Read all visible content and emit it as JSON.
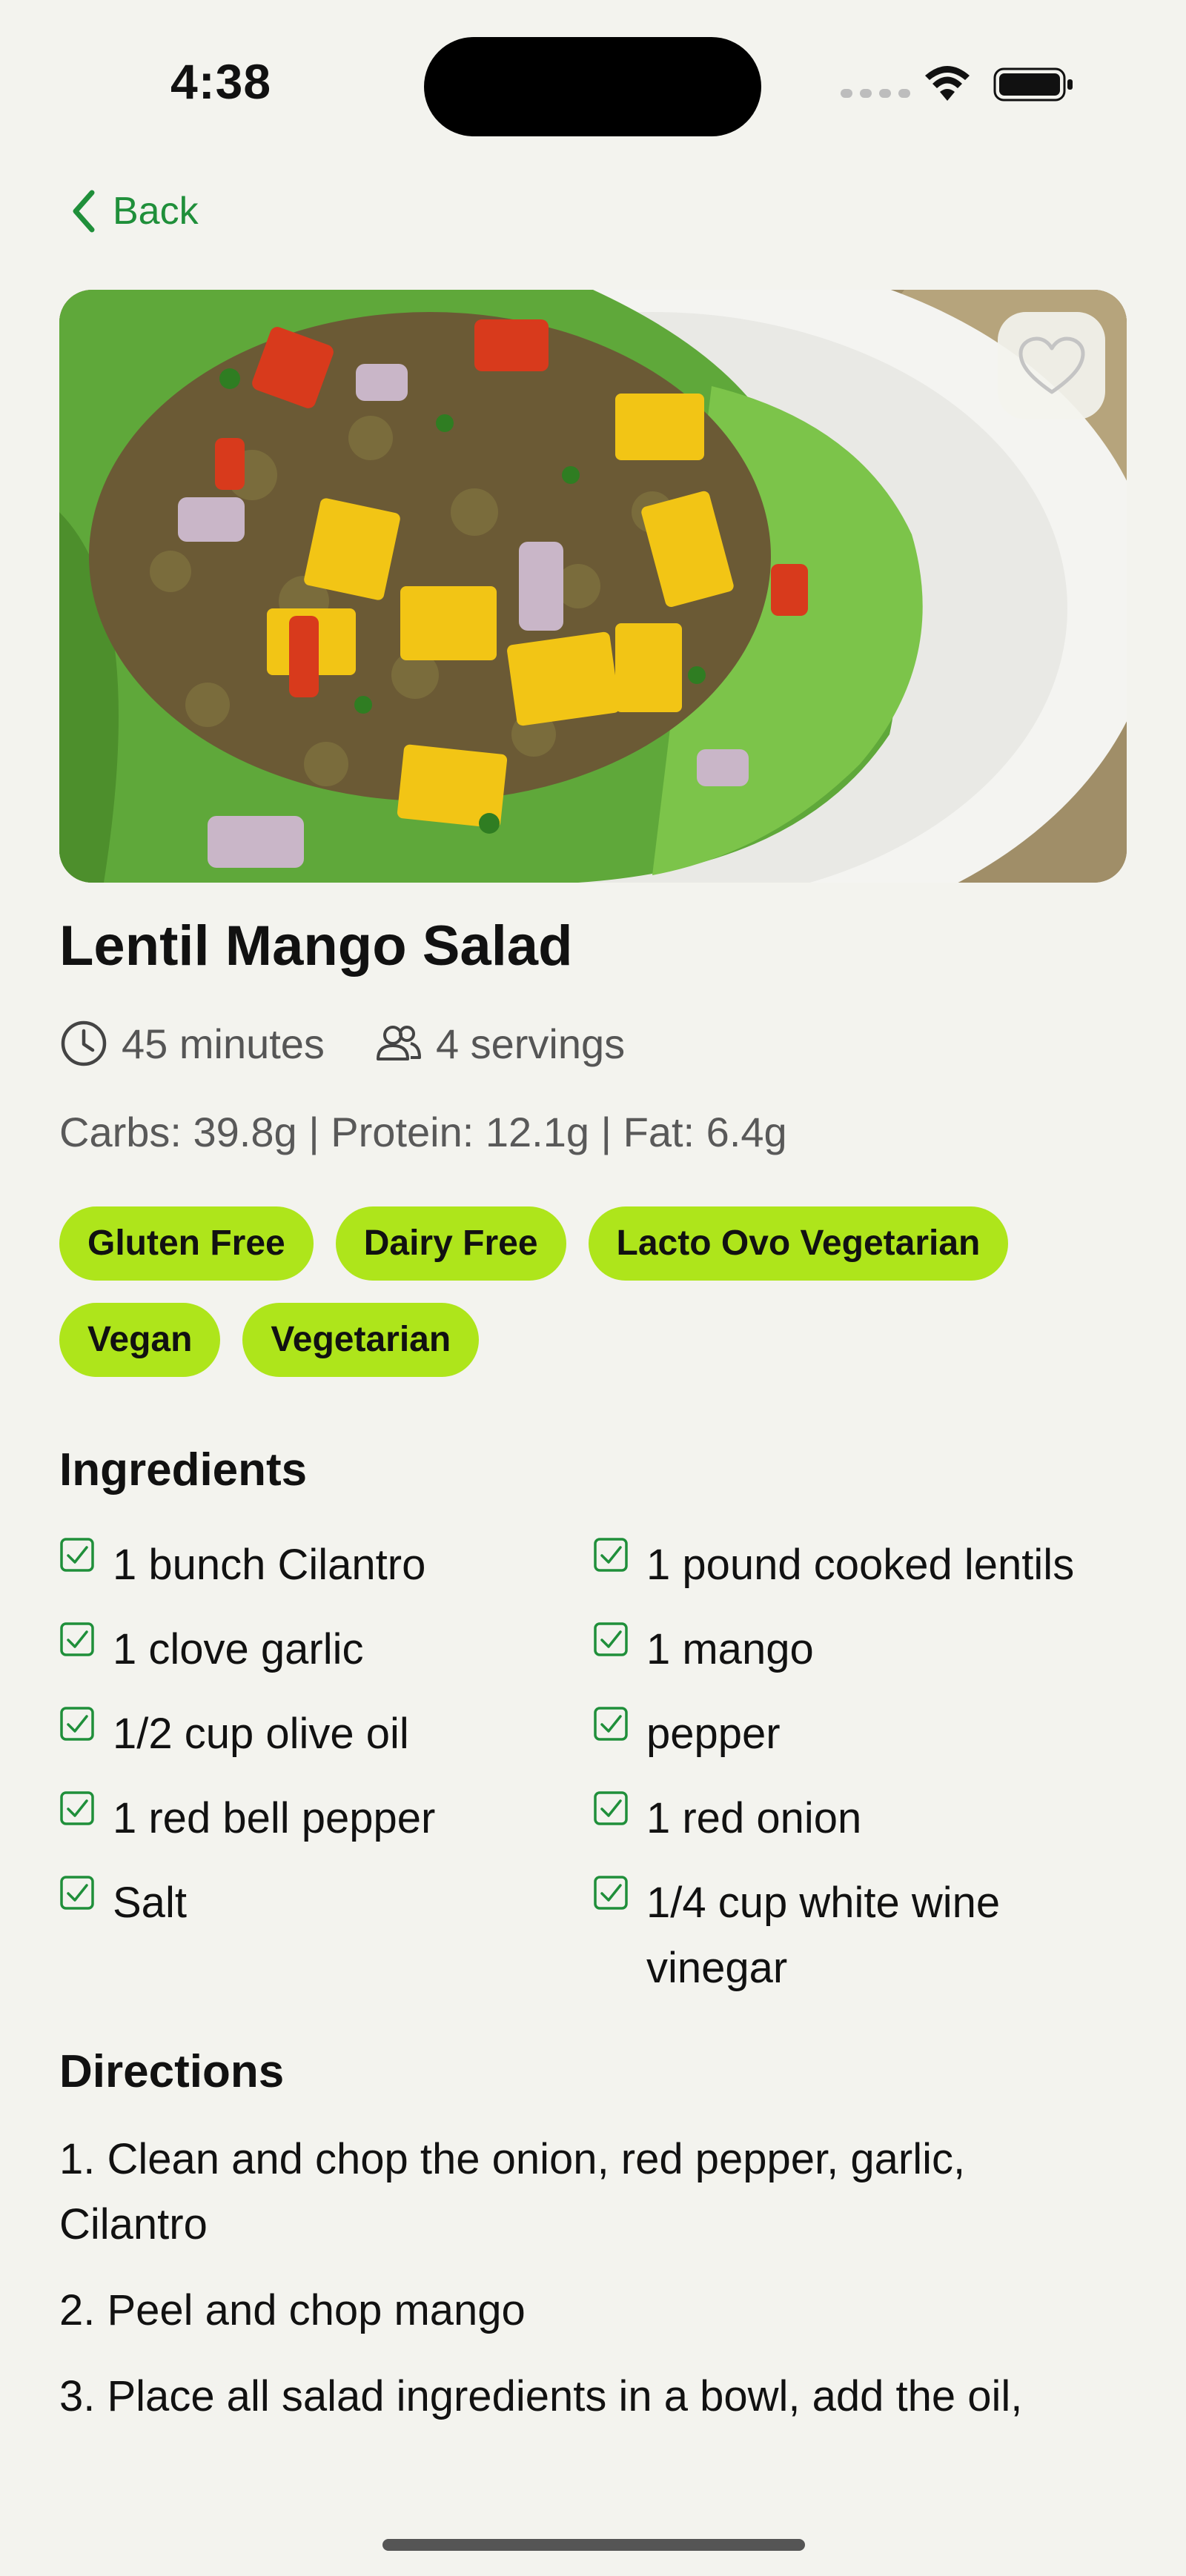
{
  "status_bar": {
    "time": "4:38"
  },
  "nav": {
    "back_label": "Back"
  },
  "recipe": {
    "title": "Lentil Mango Salad",
    "time": "45 minutes",
    "servings": "4 servings",
    "nutrition": "Carbs: 39.8g | Protein: 12.1g | Fat: 6.4g",
    "tags": [
      "Gluten Free",
      "Dairy Free",
      "Lacto Ovo Vegetarian",
      "Vegan",
      "Vegetarian"
    ]
  },
  "ingredients": {
    "title": "Ingredients",
    "items": [
      "1 bunch Cilantro",
      "1 pound cooked lentils",
      "1 clove garlic",
      "1 mango",
      "1/2 cup olive oil",
      "pepper",
      "1 red bell pepper",
      "1 red onion",
      "Salt",
      "1/4 cup white wine vinegar"
    ]
  },
  "directions": {
    "title": "Directions",
    "steps": [
      "1. Clean and chop the onion, red pepper, garlic, Cilantro",
      "2. Peel and chop mango",
      "3. Place all salad ingredients in a bowl, add the oil,"
    ]
  },
  "colors": {
    "accent": "#1f8f3a",
    "tag_bg": "#aee51b",
    "background": "#f3f3ee"
  },
  "icons": [
    "chevron-left-icon",
    "heart-icon",
    "clock-icon",
    "people-icon",
    "checkbox-checked-icon",
    "wifi-icon",
    "battery-icon",
    "signal-icon"
  ]
}
